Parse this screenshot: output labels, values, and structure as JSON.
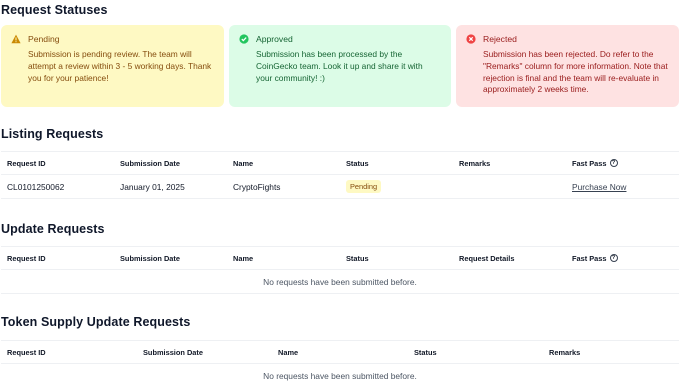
{
  "statuses": {
    "heading": "Request Statuses",
    "pending": {
      "title": "Pending",
      "text": "Submission is pending review. The team will attempt a review within 3 - 5 working days. Thank you for your patience!",
      "color": "#854d0e",
      "bg": "#fef9c3"
    },
    "approved": {
      "title": "Approved",
      "text": "Submission has been processed by the CoinGecko team. Look it up and share it with your community! :)",
      "color": "#166534",
      "bg": "#dcfce7"
    },
    "rejected": {
      "title": "Rejected",
      "text": "Submission has been rejected. Do refer to the \"Remarks\" column for more information. Note that rejection is final and the team will re-evaluate in approximately 2 weeks time.",
      "color": "#991b1b",
      "bg": "#fee2e2"
    }
  },
  "listing": {
    "heading": "Listing Requests",
    "columns": [
      "Request ID",
      "Submission Date",
      "Name",
      "Status",
      "Remarks",
      "Fast Pass"
    ],
    "rows": [
      {
        "id": "CL0101250062",
        "date": "January 01, 2025",
        "name": "CryptoFights",
        "status": "Pending",
        "remarks": "",
        "fast_pass": "Purchase Now"
      }
    ]
  },
  "update": {
    "heading": "Update Requests",
    "columns": [
      "Request ID",
      "Submission Date",
      "Name",
      "Status",
      "Request Details",
      "Fast Pass"
    ],
    "empty": "No requests have been submitted before."
  },
  "token_supply": {
    "heading": "Token Supply Update Requests",
    "columns": [
      "Request ID",
      "Submission Date",
      "Name",
      "Status",
      "Remarks"
    ],
    "empty": "No requests have been submitted before."
  }
}
